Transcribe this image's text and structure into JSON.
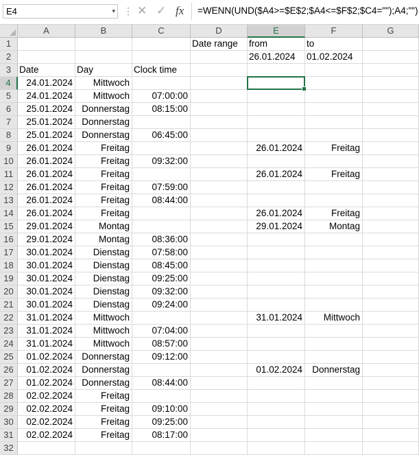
{
  "namebox": "E4",
  "formula": "=WENN(UND($A4>=$E$2;$A4<=$F$2;$C4=\"\");A4;\"\")",
  "selected_cell": "E4",
  "columns": [
    "A",
    "B",
    "C",
    "D",
    "E",
    "F",
    "G"
  ],
  "row_numbers": [
    "1",
    "2",
    "3",
    "4",
    "5",
    "6",
    "7",
    "8",
    "9",
    "10",
    "11",
    "12",
    "13",
    "14",
    "15",
    "16",
    "17",
    "18",
    "19",
    "20",
    "21",
    "22",
    "23",
    "24",
    "25",
    "26",
    "27",
    "28",
    "29",
    "30",
    "31",
    "32"
  ],
  "rows": [
    [
      "",
      "",
      "",
      "Date range",
      "from",
      "to",
      ""
    ],
    [
      "",
      "",
      "",
      "",
      "26.01.2024",
      "01.02.2024",
      ""
    ],
    [
      "Date",
      "Day",
      "Clock time",
      "",
      "",
      "",
      ""
    ],
    [
      "24.01.2024",
      "Mittwoch",
      "",
      "",
      "",
      "",
      ""
    ],
    [
      "24.01.2024",
      "Mittwoch",
      "07:00:00",
      "",
      "",
      "",
      ""
    ],
    [
      "25.01.2024",
      "Donnerstag",
      "08:15:00",
      "",
      "",
      "",
      ""
    ],
    [
      "25.01.2024",
      "Donnerstag",
      "",
      "",
      "",
      "",
      ""
    ],
    [
      "25.01.2024",
      "Donnerstag",
      "06:45:00",
      "",
      "",
      "",
      ""
    ],
    [
      "26.01.2024",
      "Freitag",
      "",
      "",
      "26.01.2024",
      "Freitag",
      ""
    ],
    [
      "26.01.2024",
      "Freitag",
      "09:32:00",
      "",
      "",
      "",
      ""
    ],
    [
      "26.01.2024",
      "Freitag",
      "",
      "",
      "26.01.2024",
      "Freitag",
      ""
    ],
    [
      "26.01.2024",
      "Freitag",
      "07:59:00",
      "",
      "",
      "",
      ""
    ],
    [
      "26.01.2024",
      "Freitag",
      "08:44:00",
      "",
      "",
      "",
      ""
    ],
    [
      "26.01.2024",
      "Freitag",
      "",
      "",
      "26.01.2024",
      "Freitag",
      ""
    ],
    [
      "29.01.2024",
      "Montag",
      "",
      "",
      "29.01.2024",
      "Montag",
      ""
    ],
    [
      "29.01.2024",
      "Montag",
      "08:36:00",
      "",
      "",
      "",
      ""
    ],
    [
      "30.01.2024",
      "Dienstag",
      "07:58:00",
      "",
      "",
      "",
      ""
    ],
    [
      "30.01.2024",
      "Dienstag",
      "08:45:00",
      "",
      "",
      "",
      ""
    ],
    [
      "30.01.2024",
      "Dienstag",
      "09:25:00",
      "",
      "",
      "",
      ""
    ],
    [
      "30.01.2024",
      "Dienstag",
      "09:32:00",
      "",
      "",
      "",
      ""
    ],
    [
      "30.01.2024",
      "Dienstag",
      "09:24:00",
      "",
      "",
      "",
      ""
    ],
    [
      "31.01.2024",
      "Mittwoch",
      "",
      "",
      "31.01.2024",
      "Mittwoch",
      ""
    ],
    [
      "31.01.2024",
      "Mittwoch",
      "07:04:00",
      "",
      "",
      "",
      ""
    ],
    [
      "31.01.2024",
      "Mittwoch",
      "08:57:00",
      "",
      "",
      "",
      ""
    ],
    [
      "01.02.2024",
      "Donnerstag",
      "09:12:00",
      "",
      "",
      "",
      ""
    ],
    [
      "01.02.2024",
      "Donnerstag",
      "",
      "",
      "01.02.2024",
      "Donnerstag",
      ""
    ],
    [
      "01.02.2024",
      "Donnerstag",
      "08:44:00",
      "",
      "",
      "",
      ""
    ],
    [
      "02.02.2024",
      "Freitag",
      "",
      "",
      "",
      "",
      ""
    ],
    [
      "02.02.2024",
      "Freitag",
      "09:10:00",
      "",
      "",
      "",
      ""
    ],
    [
      "02.02.2024",
      "Freitag",
      "09:25:00",
      "",
      "",
      "",
      ""
    ],
    [
      "02.02.2024",
      "Freitag",
      "08:17:00",
      "",
      "",
      "",
      ""
    ],
    [
      "",
      "",
      "",
      "",
      "",
      "",
      ""
    ]
  ],
  "colors": {
    "accent": "#217346",
    "header_bg": "#e6e6e6",
    "gridline": "#dadada"
  }
}
